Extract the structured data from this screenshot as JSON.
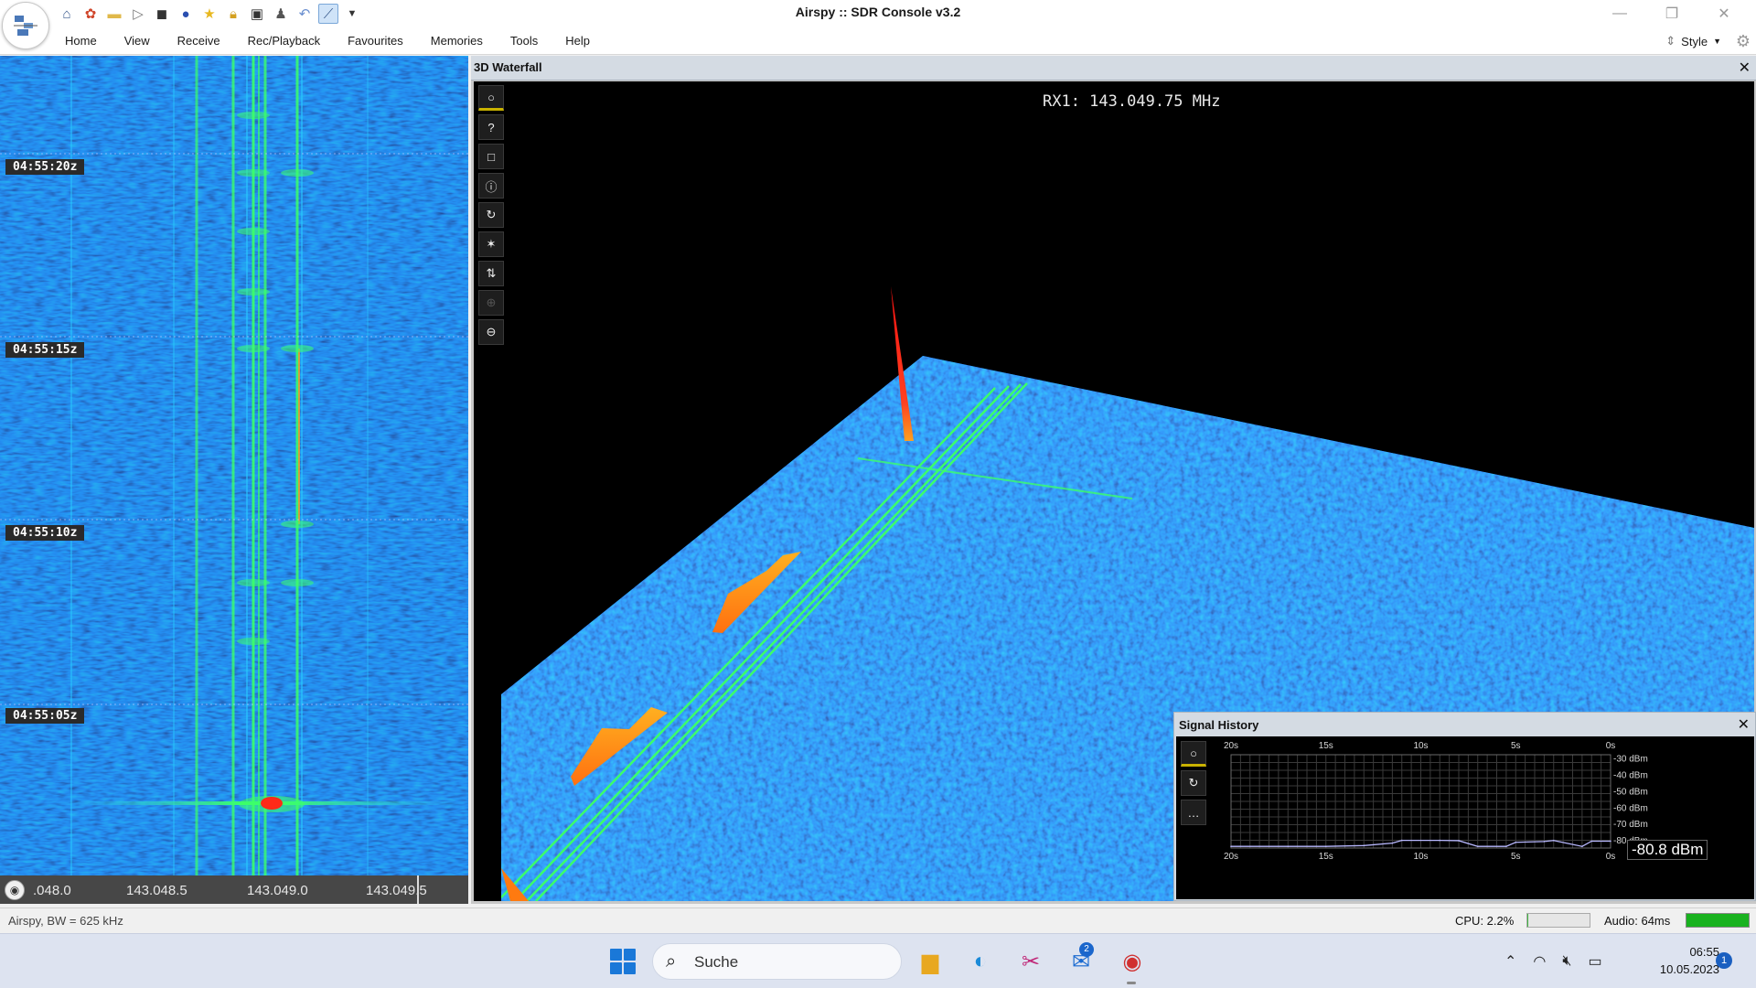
{
  "window": {
    "title": "Airspy :: SDR Console v3.2",
    "minimize_icon": "minimize-icon",
    "restore_icon": "restore-icon",
    "close_icon": "close-icon"
  },
  "quick_access_icons": [
    "home-icon",
    "radio-icon",
    "folder-icon",
    "play-icon",
    "stop-icon",
    "record-icon",
    "star-icon",
    "lock-icon",
    "camera-icon",
    "person-icon",
    "undo-icon",
    "display-icon",
    "dropdown-icon"
  ],
  "menu": {
    "items": [
      "Home",
      "View",
      "Receive",
      "Rec/Playback",
      "Favourites",
      "Memories",
      "Tools",
      "Help"
    ],
    "style_label": "Style"
  },
  "left_waterfall": {
    "time_labels": [
      "04:55:20z",
      "04:55:15z",
      "04:55:10z",
      "04:55:05z"
    ],
    "freq_ticks": [
      ".048.0",
      "143.048.5",
      "143.049.0",
      "143.049.5"
    ]
  },
  "waterfall3d": {
    "title": "3D Waterfall",
    "rx_label": "RX1: 143.049.75 MHz",
    "toolbar_icons": [
      "circle-icon",
      "help-icon",
      "square-icon",
      "info-icon",
      "rotate-icon",
      "star-icon",
      "updown-icon",
      "crosshair-icon",
      "zoom-out-icon"
    ]
  },
  "signal_history": {
    "title": "Signal History",
    "current_value": "-80.8 dBm",
    "time_labels": [
      "20s",
      "15s",
      "10s",
      "5s",
      "0s"
    ],
    "dbm_labels": [
      "-30 dBm",
      "-40 dBm",
      "-50 dBm",
      "-60 dBm",
      "-70 dBm",
      "-80 dBm"
    ],
    "toolbar_icons": [
      "circle-icon",
      "rotate-icon",
      "more-icon"
    ],
    "chart_data": {
      "type": "line",
      "x": [
        -20,
        -17,
        -15,
        -13,
        -11.5,
        -11,
        -9,
        -8,
        -7,
        -5.5,
        -5,
        -3.5,
        -3,
        -1.5,
        -1,
        0
      ],
      "y": [
        -84,
        -84,
        -84,
        -83.5,
        -82,
        -80.3,
        -80.3,
        -80.5,
        -84,
        -84,
        -81.5,
        -81,
        -80.4,
        -84,
        -80.8,
        -80.8
      ],
      "xlabel": "",
      "ylabel": "",
      "ylim": [
        -85,
        -28
      ],
      "grid": true
    }
  },
  "status": {
    "left": "Airspy, BW = 625 kHz",
    "cpu": "CPU: 2.2%",
    "cpu_fraction": 0.02,
    "audio": "Audio: 64ms",
    "audio_fraction": 1.0
  },
  "taskbar": {
    "search_placeholder": "Suche",
    "mail_badge": "2",
    "time": "06:55",
    "date": "10.05.2023",
    "notification_count": "1"
  },
  "colors": {
    "waterfall_bg": "#08105e",
    "signal_green": "#3cff6a",
    "signal_cyan": "#28c8ff",
    "peak_red": "#ff2020",
    "peak_orange": "#ff9a1c",
    "accent_blue": "#1a78d8"
  }
}
